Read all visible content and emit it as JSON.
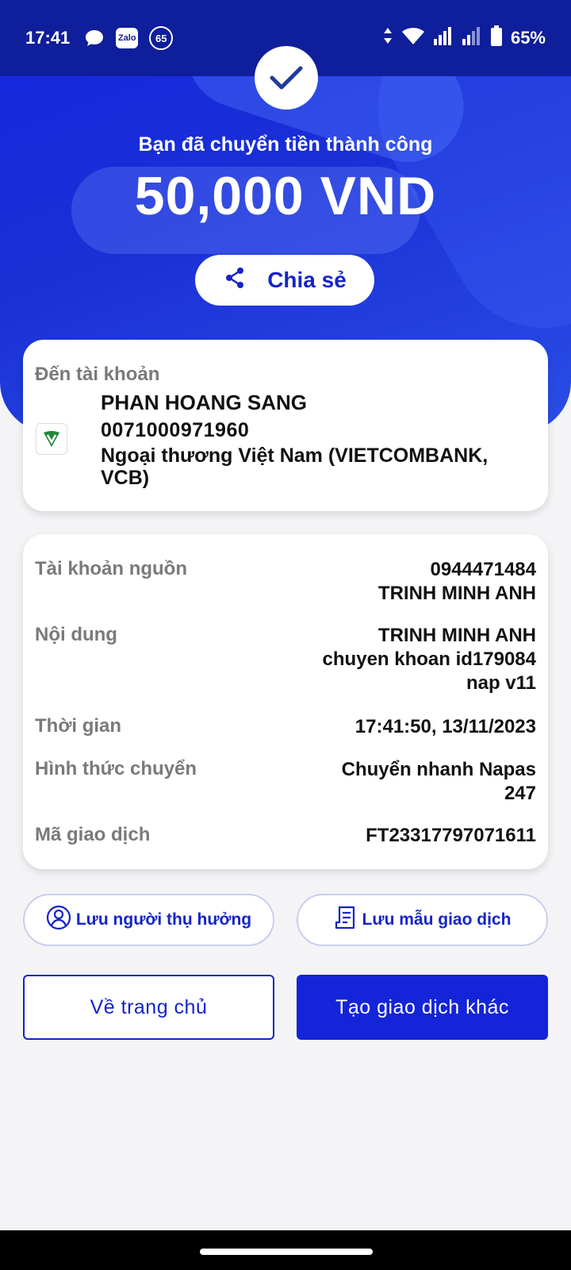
{
  "status_bar": {
    "time": "17:41",
    "zalo_label": "Zalo",
    "badge": "65",
    "battery": "65%"
  },
  "hero": {
    "title": "Bạn đã chuyển tiền thành công",
    "amount": "50,000 VND",
    "share_label": "Chia sẻ"
  },
  "recipient": {
    "label": "Đến tài khoản",
    "name": "PHAN HOANG SANG",
    "account": "0071000971960",
    "bank": "Ngoại thương Việt Nam (VIETCOMBANK, VCB)"
  },
  "details": {
    "source_label": "Tài khoản nguồn",
    "source_account": "0944471484",
    "source_name": "TRINH MINH ANH",
    "content_label": "Nội dung",
    "content_line1": "TRINH MINH ANH",
    "content_line2": "chuyen khoan id179084",
    "content_line3": "nap v11",
    "time_label": "Thời gian",
    "time_value": "17:41:50, 13/11/2023",
    "method_label": "Hình thức chuyển",
    "method_line1": "Chuyển nhanh Napas",
    "method_line2": "247",
    "txn_label": "Mã giao dịch",
    "txn_value": "FT23317797071611"
  },
  "actions": {
    "save_beneficiary": "Lưu người thụ hưởng",
    "save_template": "Lưu mẫu giao dịch",
    "home": "Về trang chủ",
    "new_transaction": "Tạo giao dịch khác"
  },
  "colors": {
    "primary": "#1424d8",
    "hero": "#1a2fd6",
    "status_bar": "#0f1e9a"
  }
}
